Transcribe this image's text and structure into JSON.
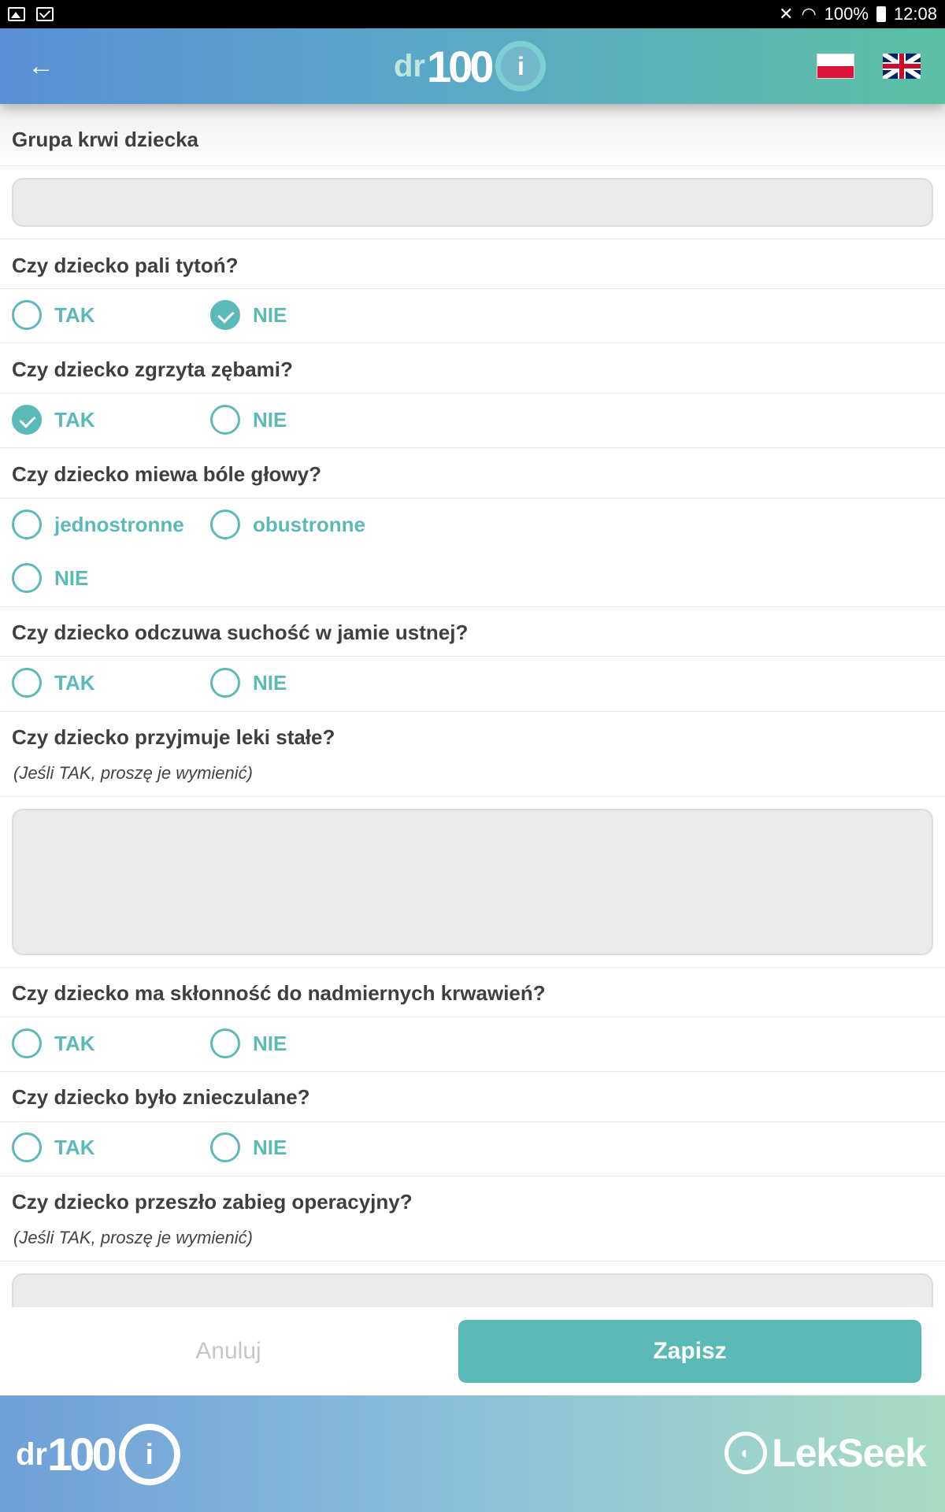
{
  "status_bar": {
    "battery": "100%",
    "time": "12:08"
  },
  "header": {
    "logo_dr": "dr",
    "logo_num": "100",
    "logo_mark": "i"
  },
  "questions": {
    "blood_group": {
      "title": "Grupa krwi dziecka",
      "value": ""
    },
    "smokes": {
      "title": "Czy dziecko pali tytoń?",
      "yes": "TAK",
      "no": "NIE",
      "selected": "NIE"
    },
    "grinds": {
      "title": "Czy dziecko zgrzyta zębami?",
      "yes": "TAK",
      "no": "NIE",
      "selected": "TAK"
    },
    "headaches": {
      "title": "Czy dziecko miewa bóle głowy?",
      "opt1": "jednostronne",
      "opt2": "obustronne",
      "opt3": "NIE"
    },
    "dry_mouth": {
      "title": "Czy dziecko odczuwa suchość w jamie ustnej?",
      "yes": "TAK",
      "no": "NIE"
    },
    "medication": {
      "title": "Czy dziecko przyjmuje leki stałe?",
      "note": "(Jeśli TAK, proszę je wymienić)",
      "value": ""
    },
    "bleeding": {
      "title": "Czy dziecko ma skłonność do nadmiernych krwawień?",
      "yes": "TAK",
      "no": "NIE"
    },
    "anesthesia": {
      "title": "Czy dziecko było znieczulane?",
      "yes": "TAK",
      "no": "NIE"
    },
    "surgery": {
      "title": "Czy dziecko przeszło zabieg operacyjny?",
      "note": "(Jeśli TAK, proszę je wymienić)",
      "value": ""
    }
  },
  "actions": {
    "cancel": "Anuluj",
    "save": "Zapisz"
  },
  "banner": {
    "dr": "dr",
    "num": "100",
    "mark": "i",
    "partner": "LekSeek"
  },
  "colors": {
    "accent": "#5bbab7",
    "header_start": "#5b8fd6",
    "header_end": "#5cbfa3"
  }
}
